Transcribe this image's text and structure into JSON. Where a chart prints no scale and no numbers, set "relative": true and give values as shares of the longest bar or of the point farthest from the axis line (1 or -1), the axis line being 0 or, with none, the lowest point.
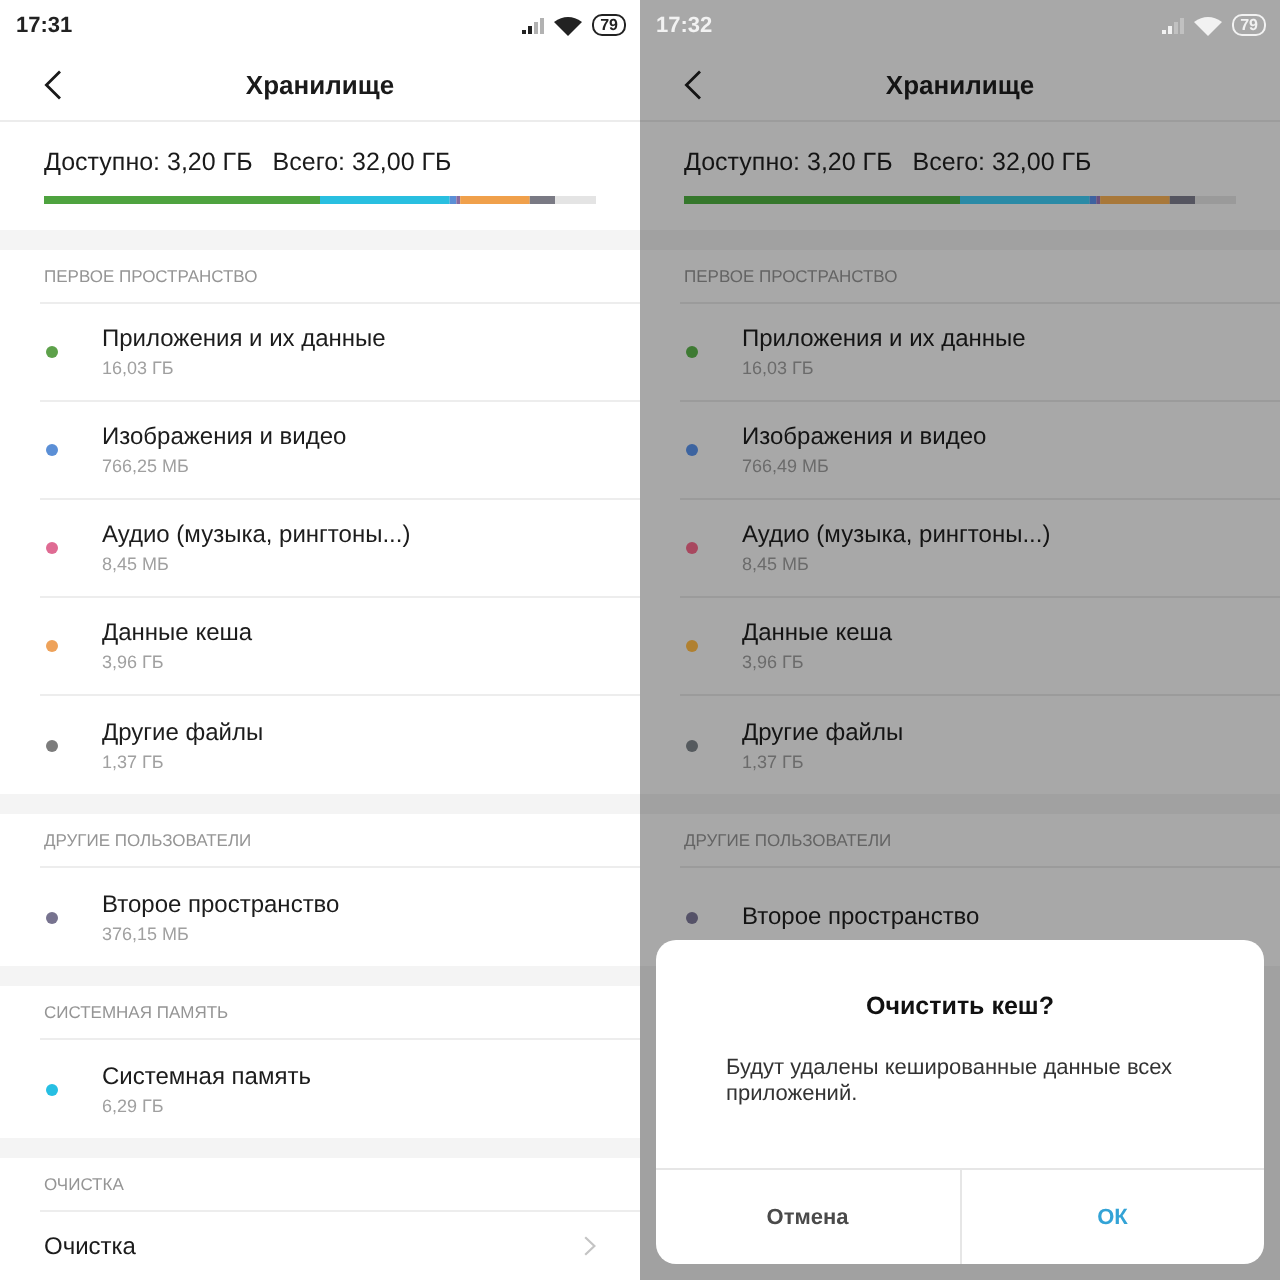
{
  "screens": [
    {
      "dimmed": false,
      "status_bar": {
        "time": "17:31",
        "battery": "79"
      },
      "header": {
        "title": "Хранилище"
      },
      "summary": {
        "available": "Доступно: 3,20 ГБ",
        "total": "Всего: 32,00 ГБ"
      },
      "storage_bar": {
        "chart_data": {
          "type": "bar",
          "orientation": "horizontal",
          "stacked": true,
          "relative": true,
          "series": [
            {
              "color": "#4ea33f",
              "values": [
                0.5
              ]
            },
            {
              "color": "#29bfe0",
              "values": [
                0.235
              ]
            },
            {
              "color": "#5b8fd6",
              "values": [
                0.012
              ]
            },
            {
              "color": "#8a6a9e",
              "values": [
                0.007
              ]
            },
            {
              "color": "#f0a04b",
              "values": [
                0.126
              ]
            },
            {
              "color": "#7a7a84",
              "values": [
                0.046
              ]
            },
            {
              "color": "#e4e4e4",
              "values": [
                0.074
              ]
            }
          ]
        }
      },
      "sections": [
        {
          "title": "ПЕРВОЕ ПРОСТРАНСТВО",
          "items": [
            {
              "kind": "storage",
              "name": "Приложения и их данные",
              "size": "16,03 ГБ",
              "color": "#5da14a"
            },
            {
              "kind": "storage",
              "name": "Изображения и видео",
              "size": "766,25 МБ",
              "color": "#5b8fd6"
            },
            {
              "kind": "storage",
              "name": "Аудио (музыка, рингтоны...)",
              "size": "8,45 МБ",
              "color": "#df6b93"
            },
            {
              "kind": "storage",
              "name": "Данные кеша",
              "size": "3,96 ГБ",
              "color": "#eea25a"
            },
            {
              "kind": "storage",
              "name": "Другие файлы",
              "size": "1,37 ГБ",
              "color": "#7c7c7c"
            }
          ]
        },
        {
          "title": "ДРУГИЕ ПОЛЬЗОВАТЕЛИ",
          "items": [
            {
              "kind": "storage",
              "name": "Второе пространство",
              "size": "376,15 МБ",
              "color": "#77738f"
            }
          ]
        },
        {
          "title": "СИСТЕМНАЯ ПАМЯТЬ",
          "items": [
            {
              "kind": "storage",
              "name": "Системная память",
              "size": "6,29 ГБ",
              "color": "#26bfe3"
            }
          ]
        },
        {
          "title": "ОЧИСТКА",
          "items": [
            {
              "kind": "link",
              "name": "Очистка"
            }
          ]
        }
      ]
    },
    {
      "dimmed": true,
      "status_bar": {
        "time": "17:32",
        "battery": "79"
      },
      "header": {
        "title": "Хранилище"
      },
      "summary": {
        "available": "Доступно: 3,20 ГБ",
        "total": "Всего: 32,00 ГБ"
      },
      "storage_bar": {
        "chart_data": {
          "type": "bar",
          "orientation": "horizontal",
          "stacked": true,
          "relative": true,
          "series": [
            {
              "color": "#35772c",
              "values": [
                0.5
              ]
            },
            {
              "color": "#2a8aa6",
              "values": [
                0.235
              ]
            },
            {
              "color": "#3e62a0",
              "values": [
                0.012
              ]
            },
            {
              "color": "#6a4f7e",
              "values": [
                0.007
              ]
            },
            {
              "color": "#a8783a",
              "values": [
                0.126
              ]
            },
            {
              "color": "#555560",
              "values": [
                0.046
              ]
            },
            {
              "color": "#9a9a9a",
              "values": [
                0.074
              ]
            }
          ]
        }
      },
      "sections": [
        {
          "title": "ПЕРВОЕ ПРОСТРАНСТВО",
          "items": [
            {
              "kind": "storage",
              "name": "Приложения и их данные",
              "size": "16,03 ГБ",
              "color": "#3e7a33"
            },
            {
              "kind": "storage",
              "name": "Изображения и видео",
              "size": "766,49 МБ",
              "color": "#3d64a0"
            },
            {
              "kind": "storage",
              "name": "Аудио (музыка, рингтоны...)",
              "size": "8,45 МБ",
              "color": "#a8485f"
            },
            {
              "kind": "storage",
              "name": "Данные кеша",
              "size": "3,96 ГБ",
              "color": "#b08030"
            },
            {
              "kind": "storage",
              "name": "Другие файлы",
              "size": "1,37 ГБ",
              "color": "#555a5e"
            }
          ]
        },
        {
          "title": "ДРУГИЕ ПОЛЬЗОВАТЕЛИ",
          "items": [
            {
              "kind": "storage",
              "name": "Второе пространство",
              "color": "#555268"
            }
          ]
        }
      ],
      "dialog": {
        "title": "Очистить кеш?",
        "message": "Будут удалены кешированные данные всех приложений.",
        "buttons": [
          {
            "label": "Отмена",
            "kind": "neutral"
          },
          {
            "label": "ОК",
            "kind": "primary"
          }
        ]
      }
    }
  ]
}
